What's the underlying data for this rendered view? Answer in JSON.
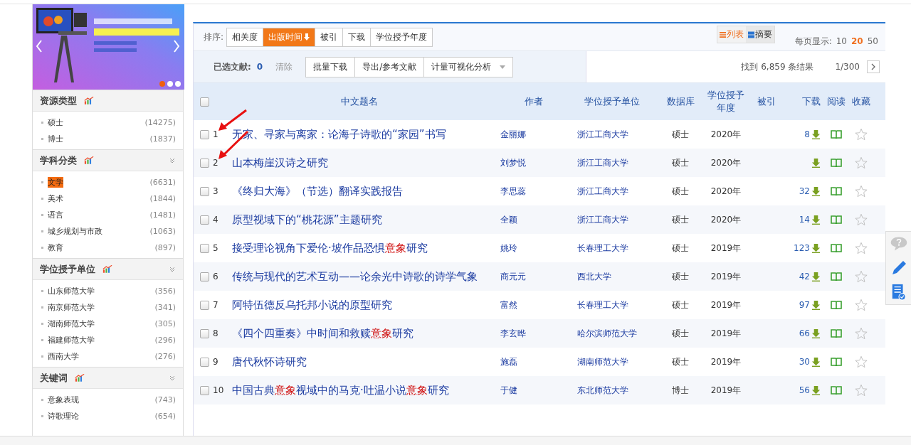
{
  "banner": {
    "kind": "picture",
    "slides": [
      {
        "selected": true
      },
      {
        "selected": false
      },
      {
        "selected": false
      }
    ]
  },
  "sidebar": [
    {
      "title": "资源类型",
      "collapsible": false,
      "items": [
        {
          "name": "硕士",
          "count": "(14275)",
          "selected": false
        },
        {
          "name": "博士",
          "count": "(1837)",
          "selected": false
        }
      ]
    },
    {
      "title": "学科分类",
      "collapsible": true,
      "items": [
        {
          "name": "文学",
          "count": "(6631)",
          "selected": true
        },
        {
          "name": "美术",
          "count": "(1844)",
          "selected": false
        },
        {
          "name": "语言",
          "count": "(1481)",
          "selected": false
        },
        {
          "name": "城乡规划与市政",
          "count": "(1063)",
          "selected": false
        },
        {
          "name": "教育",
          "count": "(897)",
          "selected": false
        }
      ]
    },
    {
      "title": "学位授予单位",
      "collapsible": true,
      "items": [
        {
          "name": "山东师范大学",
          "count": "(356)",
          "selected": false
        },
        {
          "name": "南京师范大学",
          "count": "(341)",
          "selected": false
        },
        {
          "name": "湖南师范大学",
          "count": "(305)",
          "selected": false
        },
        {
          "name": "福建师范大学",
          "count": "(296)",
          "selected": false
        },
        {
          "name": "西南大学",
          "count": "(276)",
          "selected": false
        }
      ]
    },
    {
      "title": "关键词",
      "collapsible": true,
      "items": [
        {
          "name": "意象表现",
          "count": "(743)",
          "selected": false
        },
        {
          "name": "诗歌理论",
          "count": "(654)",
          "selected": false
        }
      ]
    }
  ],
  "sort": {
    "label": "排序:",
    "options": [
      {
        "label": "相关度",
        "selected": false
      },
      {
        "label": "出版时间",
        "selected": true
      },
      {
        "label": "被引",
        "selected": false
      },
      {
        "label": "下载",
        "selected": false
      },
      {
        "label": "学位授予年度",
        "selected": false
      }
    ]
  },
  "views": [
    {
      "label": "列表",
      "selected": true
    },
    {
      "label": "摘要",
      "selected": false
    }
  ],
  "page_size": {
    "label": "每页显示:",
    "options": [
      {
        "label": "10",
        "selected": false
      },
      {
        "label": "20",
        "selected": true
      },
      {
        "label": "50",
        "selected": false
      }
    ]
  },
  "toolbar": {
    "selected_label": "已选文献:",
    "selected_count": "0",
    "clear": "清除",
    "buttons": [
      {
        "label": "批量下载",
        "kind": "plain"
      },
      {
        "label": "导出/参考文献",
        "kind": "plain"
      },
      {
        "label": "计量可视化分析",
        "kind": "dropdown"
      }
    ],
    "result_count": "找到 6,859 条结果",
    "page": "1/300"
  },
  "table": {
    "all_checked": false,
    "columns": [
      "中文题名",
      "作者",
      "学位授予单位",
      "数据库",
      "学位授予年度",
      "被引",
      "下载",
      "阅读",
      "收藏"
    ],
    "rows": [
      {
        "num": "1",
        "title": [
          {
            "text": "无家、寻家与离家：论海子诗歌的“家园”书写",
            "highlight": false
          }
        ],
        "author": "金丽娜",
        "unit": "浙江工商大学",
        "db": "硕士",
        "year": "2020年",
        "downloads": "8",
        "checked": false
      },
      {
        "num": "2",
        "title": [
          {
            "text": "山本梅崖汉诗之研究",
            "highlight": false
          }
        ],
        "author": "刘梦悦",
        "unit": "浙江工商大学",
        "db": "硕士",
        "year": "2020年",
        "checked": false
      },
      {
        "num": "3",
        "title": [
          {
            "text": "《终归大海》（节选）翻译实践报告",
            "highlight": false
          }
        ],
        "author": "李思蕊",
        "unit": "浙江工商大学",
        "db": "硕士",
        "year": "2020年",
        "downloads": "32",
        "checked": false
      },
      {
        "num": "4",
        "title": [
          {
            "text": "原型视域下的“桃花源”主题研究",
            "highlight": false
          }
        ],
        "author": "全颖",
        "unit": "浙江工商大学",
        "db": "硕士",
        "year": "2020年",
        "downloads": "14",
        "checked": false
      },
      {
        "num": "5",
        "title": [
          {
            "text": "接受理论视角下爱伦·坡作品恐惧",
            "highlight": false
          },
          {
            "text": "意象",
            "highlight": true
          },
          {
            "text": "研究",
            "highlight": false
          }
        ],
        "author": "姚玲",
        "unit": "长春理工大学",
        "db": "硕士",
        "year": "2019年",
        "downloads": "123",
        "checked": false
      },
      {
        "num": "6",
        "title": [
          {
            "text": "传统与现代的艺术互动——论余光中诗歌的诗学气象",
            "highlight": false
          }
        ],
        "author": "商元元",
        "unit": "西北大学",
        "db": "硕士",
        "year": "2019年",
        "downloads": "42",
        "checked": false
      },
      {
        "num": "7",
        "title": [
          {
            "text": "阿特伍德反乌托邦小说的原型研究",
            "highlight": false
          }
        ],
        "author": "富然",
        "unit": "长春理工大学",
        "db": "硕士",
        "year": "2019年",
        "downloads": "97",
        "checked": false
      },
      {
        "num": "8",
        "title": [
          {
            "text": "《四个四重奏》中时间和救赎",
            "highlight": false
          },
          {
            "text": "意象",
            "highlight": true
          },
          {
            "text": "研究",
            "highlight": false
          }
        ],
        "author": "李玄晔",
        "unit": "哈尔滨师范大学",
        "db": "硕士",
        "year": "2019年",
        "downloads": "66",
        "checked": false
      },
      {
        "num": "9",
        "title": [
          {
            "text": "唐代秋怀诗研究",
            "highlight": false
          }
        ],
        "author": "施磊",
        "unit": "湖南师范大学",
        "db": "硕士",
        "year": "2019年",
        "downloads": "30",
        "checked": false
      },
      {
        "num": "10",
        "title": [
          {
            "text": "中国古典",
            "highlight": false
          },
          {
            "text": "意象",
            "highlight": true
          },
          {
            "text": "视域中的马克·吐温小说",
            "highlight": false
          },
          {
            "text": "意象",
            "highlight": true
          },
          {
            "text": "研究",
            "highlight": false
          }
        ],
        "author": "于健",
        "unit": "东北师范大学",
        "db": "博士",
        "year": "2019年",
        "downloads": "56",
        "checked": false
      }
    ]
  }
}
